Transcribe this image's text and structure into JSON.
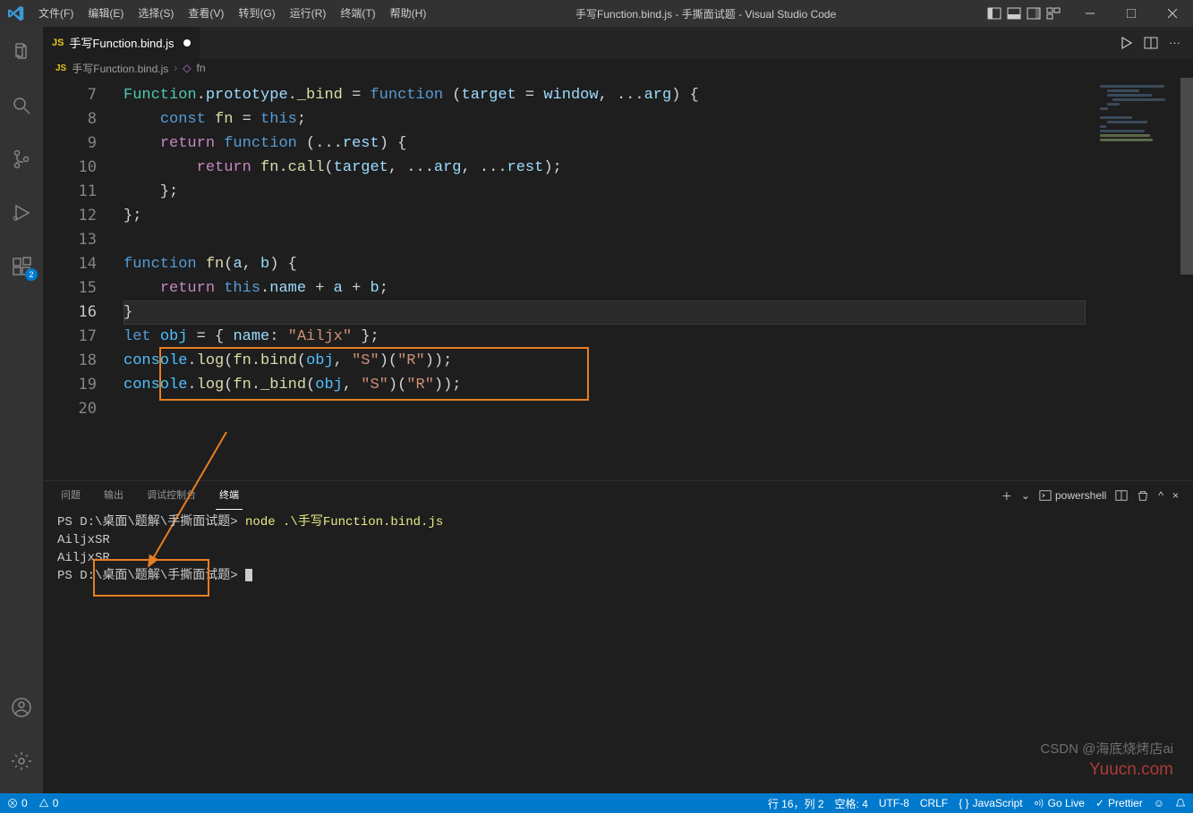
{
  "window": {
    "title": "手写Function.bind.js - 手撕面试题 - Visual Studio Code"
  },
  "menu": [
    "文件(F)",
    "编辑(E)",
    "选择(S)",
    "查看(V)",
    "转到(G)",
    "运行(R)",
    "终端(T)",
    "帮助(H)"
  ],
  "activity_badge": "2",
  "tab": {
    "icon": "JS",
    "label": "手写Function.bind.js",
    "modified": true
  },
  "breadcrumb": {
    "file_icon": "JS",
    "file": "手写Function.bind.js",
    "sep": "›",
    "sym": "fn"
  },
  "editor": {
    "first_line": 7,
    "active_line": 16,
    "lines": [
      7,
      8,
      9,
      10,
      11,
      12,
      13,
      14,
      15,
      16,
      17,
      18,
      19,
      20
    ]
  },
  "panel": {
    "tabs": [
      "问题",
      "输出",
      "调试控制台",
      "终端"
    ],
    "active": "终端",
    "shell_label": "powershell"
  },
  "terminal": {
    "prompt1": "PS D:\\桌面\\题解\\手撕面试题> ",
    "cmd1": "node .\\手写Function.bind.js",
    "out1": "AiljxSR",
    "out2": "AiljxSR",
    "prompt2": "PS D:\\桌面\\题解\\手撕面试题> "
  },
  "status": {
    "errors": "0",
    "warnings": "0",
    "ln_col": "行 16，列 2",
    "spaces": "空格: 4",
    "enc": "UTF-8",
    "eol": "CRLF",
    "lang": "JavaScript",
    "golive": "Go Live",
    "prettier": "Prettier"
  },
  "watermark": {
    "line1": "CSDN @海底烧烤店ai",
    "line2": "Yuucn.com"
  }
}
